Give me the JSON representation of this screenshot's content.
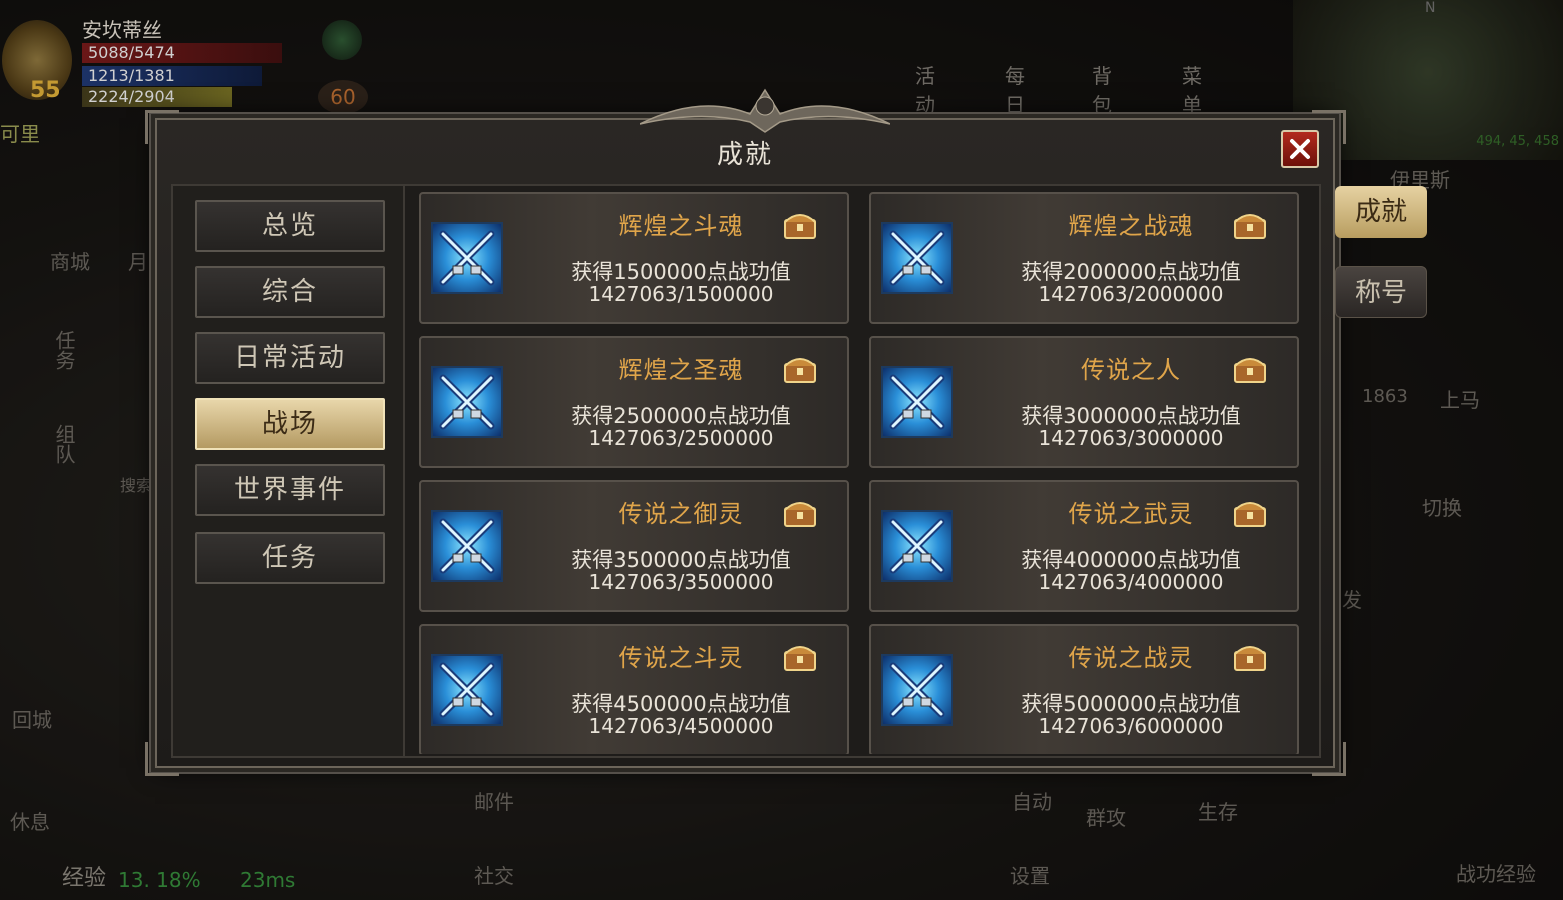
{
  "player": {
    "name": "安坎蒂丝",
    "level": "55",
    "hp": "5088/5474",
    "mp": "1213/1381",
    "xp": "2224/2904",
    "fps": "60",
    "pet_label": "可里"
  },
  "top_menu": [
    "活动",
    "每日",
    "背包",
    "菜单"
  ],
  "minimap": {
    "north": "N",
    "coords": "494, 45, 458"
  },
  "left_hud": [
    "商城",
    "月",
    "任务",
    "组队",
    "搜索",
    "回城",
    "休息"
  ],
  "right_hud": {
    "npc": "伊里斯",
    "tab_achievement": "成就",
    "tab_title": "称号",
    "count": "1863",
    "mount": "上马",
    "switch": "切换",
    "fire": "发"
  },
  "bottom_hud": {
    "exp_label": "经验",
    "exp_value": "13. 18%",
    "ping": "23ms",
    "buttons": [
      "邮件",
      "社交",
      "自动",
      "设置",
      "群攻",
      "生存"
    ],
    "battle_exp": "战功经验"
  },
  "panel": {
    "title": "成就",
    "close_label": "×",
    "nav": [
      "总览",
      "综合",
      "日常活动",
      "战场",
      "世界事件",
      "任务"
    ],
    "selected_nav": "战场",
    "achievements": [
      {
        "title": "辉煌之斗魂",
        "desc": "获得1500000点战功值",
        "progress": "1427063/1500000"
      },
      {
        "title": "辉煌之战魂",
        "desc": "获得2000000点战功值",
        "progress": "1427063/2000000"
      },
      {
        "title": "辉煌之圣魂",
        "desc": "获得2500000点战功值",
        "progress": "1427063/2500000"
      },
      {
        "title": "传说之人",
        "desc": "获得3000000点战功值",
        "progress": "1427063/3000000"
      },
      {
        "title": "传说之御灵",
        "desc": "获得3500000点战功值",
        "progress": "1427063/3500000"
      },
      {
        "title": "传说之武灵",
        "desc": "获得4000000点战功值",
        "progress": "1427063/4000000"
      },
      {
        "title": "传说之斗灵",
        "desc": "获得4500000点战功值",
        "progress": "1427063/4500000"
      },
      {
        "title": "传说之战灵",
        "desc": "获得5000000点战功值",
        "progress": "1427063/6000000"
      }
    ]
  },
  "colors": {
    "title_gold": "#e0a54a",
    "selected_tab": "#d8c392",
    "close_red": "#b22a1e"
  }
}
